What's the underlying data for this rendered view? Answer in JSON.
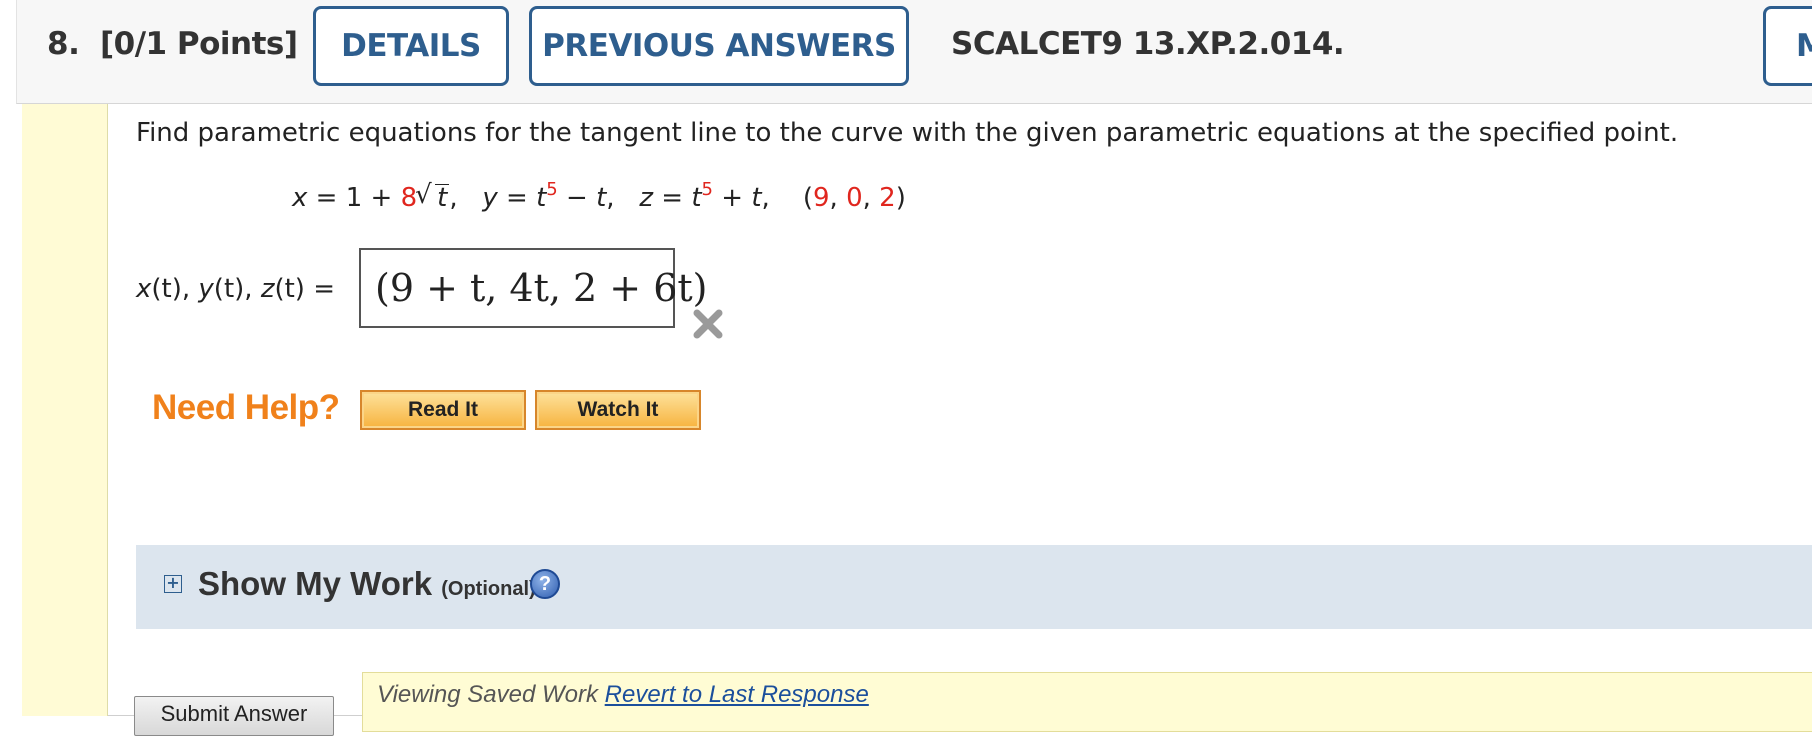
{
  "header": {
    "question_number": "8.",
    "points": "[0/1 Points]",
    "details_label": "DETAILS",
    "previous_answers_label": "PREVIOUS ANSWERS",
    "question_code": "SCALCET9 13.XP.2.014.",
    "more_label": "M"
  },
  "question": {
    "prompt": "Find parametric equations for the tangent line to the curve with the given parametric equations at the specified point.",
    "eq": {
      "x_lhs": "x",
      "x_eq": " = 1 + ",
      "x_coef": "8",
      "x_var": "t",
      "y_lhs": "y",
      "y_eq": " = ",
      "y_base": "t",
      "y_exp": "5",
      "y_tail_op": " − ",
      "y_tail": "t",
      "z_lhs": "z",
      "z_eq": " = ",
      "z_base": "t",
      "z_exp": "5",
      "z_tail_op": " + ",
      "z_tail": "t",
      "point_open": "(",
      "p1": "9",
      "p2": "0",
      "p3": "2",
      "point_close": ")"
    },
    "answer_label": {
      "x": "x",
      "y": "y",
      "z": "z",
      "arg": "(t)",
      "eq": " ="
    },
    "answer_value": "(9 + t, 4t, 2 + 6t)",
    "result_icon": "x-mark-icon"
  },
  "help": {
    "label": "Need Help?",
    "read_it": "Read It",
    "watch_it": "Watch It"
  },
  "show_my_work": {
    "title": "Show My Work",
    "optional": "(Optional)",
    "help_icon_text": "?"
  },
  "footer": {
    "submit_label": "Submit Answer",
    "saved_text": "Viewing Saved Work",
    "revert_link": "Revert to Last Response"
  },
  "colors": {
    "accent_blue": "#2e5e8e",
    "highlight_red": "#e0261e",
    "help_orange": "#f0811b",
    "show_work_bg": "#dce5ee",
    "yellow_strip": "#fffbd5"
  }
}
